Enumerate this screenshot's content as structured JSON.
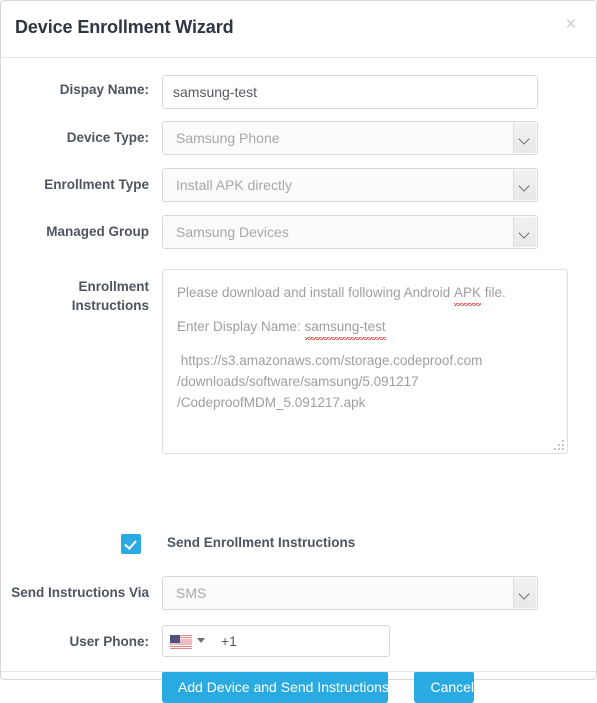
{
  "dialog": {
    "title": "Device Enrollment Wizard",
    "close_icon": "close-icon",
    "close_label": "×"
  },
  "form": {
    "display_name": {
      "label": "Dispay Name:",
      "value": "samsung-test",
      "placeholder": ""
    },
    "device_type": {
      "label": "Device Type:",
      "value": "Samsung Phone"
    },
    "enrollment_type": {
      "label": "Enrollment Type",
      "value": "Install APK directly"
    },
    "managed_group": {
      "label": "Managed Group",
      "value": "Samsung Devices"
    },
    "enrollment_instructions": {
      "label": "Enrollment Instructions",
      "line1_before": "Please download and install following Android ",
      "line1_misspelled": "APK",
      "line1_after": " file.",
      "line2_before": "Enter Display Name: ",
      "line2_misspelled": "samsung-test",
      "url_line1": " https://s3.amazonaws.com/storage.codeproof.com",
      "url_line2": "/downloads/software/samsung/5.091217",
      "url_line3": "/CodeproofMDM_5.091217.apk"
    },
    "send_enrollment_instructions": {
      "label": "Send Enrollment Instructions",
      "checked": true
    },
    "send_instructions_via": {
      "label": "Send Instructions Via",
      "value": "SMS"
    },
    "user_phone": {
      "label": "User Phone:",
      "country_flag": "us-flag-icon",
      "value": "+1"
    }
  },
  "actions": {
    "submit_label": "Add Device and Send Instructions",
    "cancel_label": "Cancel"
  },
  "colors": {
    "accent": "#29abe2",
    "label_text": "#4c5560",
    "placeholder_text": "#a4a8ac",
    "input_text": "#555a60",
    "border": "#d6d8db",
    "spellcheck_underline": "#e8413a"
  }
}
